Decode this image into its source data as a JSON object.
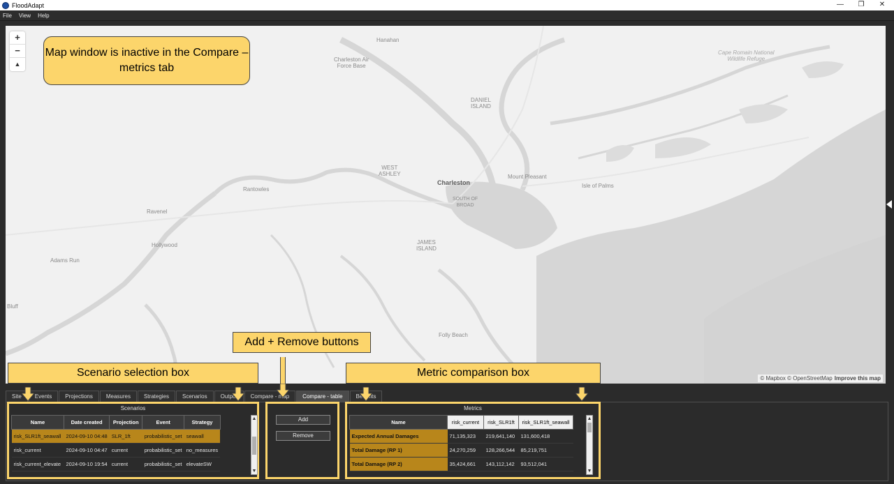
{
  "window": {
    "title": "FloodAdapt",
    "controls": [
      "—",
      "❐",
      "✕"
    ]
  },
  "menu": [
    "File",
    "View",
    "Help"
  ],
  "map": {
    "zoom_in": "+",
    "zoom_out": "−",
    "compass": "▲",
    "scale": "3km",
    "attribution": "© Mapbox © OpenStreetMap",
    "attribution_link": "Improve this map",
    "places": {
      "hanahan": "Hanahan",
      "charleston_afb": "Charleston Air\nForce Base",
      "daniel_island": "DANIEL\nISLAND",
      "cape_romain": "Cape Romain National\nWildlife Refuge",
      "rantowles": "Rantowles",
      "west_ashley": "WEST\nASHLEY",
      "charleston": "Charleston",
      "mount_pleasant": "Mount Pleasant",
      "isle_of_palms": "Isle of Palms",
      "south_of_broad": "SOUTH OF\nBROAD",
      "ravenel": "Ravenel",
      "hollywood": "Hollywood",
      "james_island": "JAMES\nISLAND",
      "adams_run": "Adams Run",
      "bluff": "Bluff",
      "folly_beach": "Folly Beach"
    }
  },
  "callouts": {
    "map": "Map window is inactive in the Compare – metrics tab",
    "add_remove": "Add + Remove buttons",
    "scenario": "Scenario selection box",
    "metric": "Metric comparison box"
  },
  "tabs": [
    "Site",
    "Events",
    "Projections",
    "Measures",
    "Strategies",
    "Scenarios",
    "Output",
    "Compare - map",
    "Compare - table",
    "Benefits"
  ],
  "active_tab": "Compare - table",
  "scenarios": {
    "title": "Scenarios",
    "columns": [
      "Name",
      "Date created",
      "Projection",
      "Event",
      "Strategy"
    ],
    "rows": [
      [
        "risk_SLR1ft_seawall",
        "2024-09-10 04:48",
        "SLR_1ft",
        "probabilistic_set",
        "seawall"
      ],
      [
        "risk_current",
        "2024-09-10 04:47",
        "current",
        "probabilistic_set",
        "no_measures"
      ],
      [
        "risk_current_elevate",
        "2024-09-10 19:54",
        "current",
        "probabilistic_set",
        "elevateSW"
      ]
    ]
  },
  "buttons": {
    "add": "Add",
    "remove": "Remove"
  },
  "metrics": {
    "title": "Metrics",
    "columns": [
      "Name",
      "risk_current",
      "risk_SLR1ft",
      "risk_SLR1ft_seawall"
    ],
    "rows": [
      [
        "Expected Annual Damages",
        "71,135,323",
        "219,641,140",
        "131,600,418"
      ],
      [
        "Total Damage (RP 1)",
        "24,270,259",
        "128,266,544",
        "85,219,751"
      ],
      [
        "Total Damage (RP 2)",
        "35,424,661",
        "143,112,142",
        "93,512,041"
      ]
    ]
  },
  "colors": {
    "accent": "#fcd56b",
    "selection": "#b8861b",
    "background": "#2b2b2b"
  }
}
